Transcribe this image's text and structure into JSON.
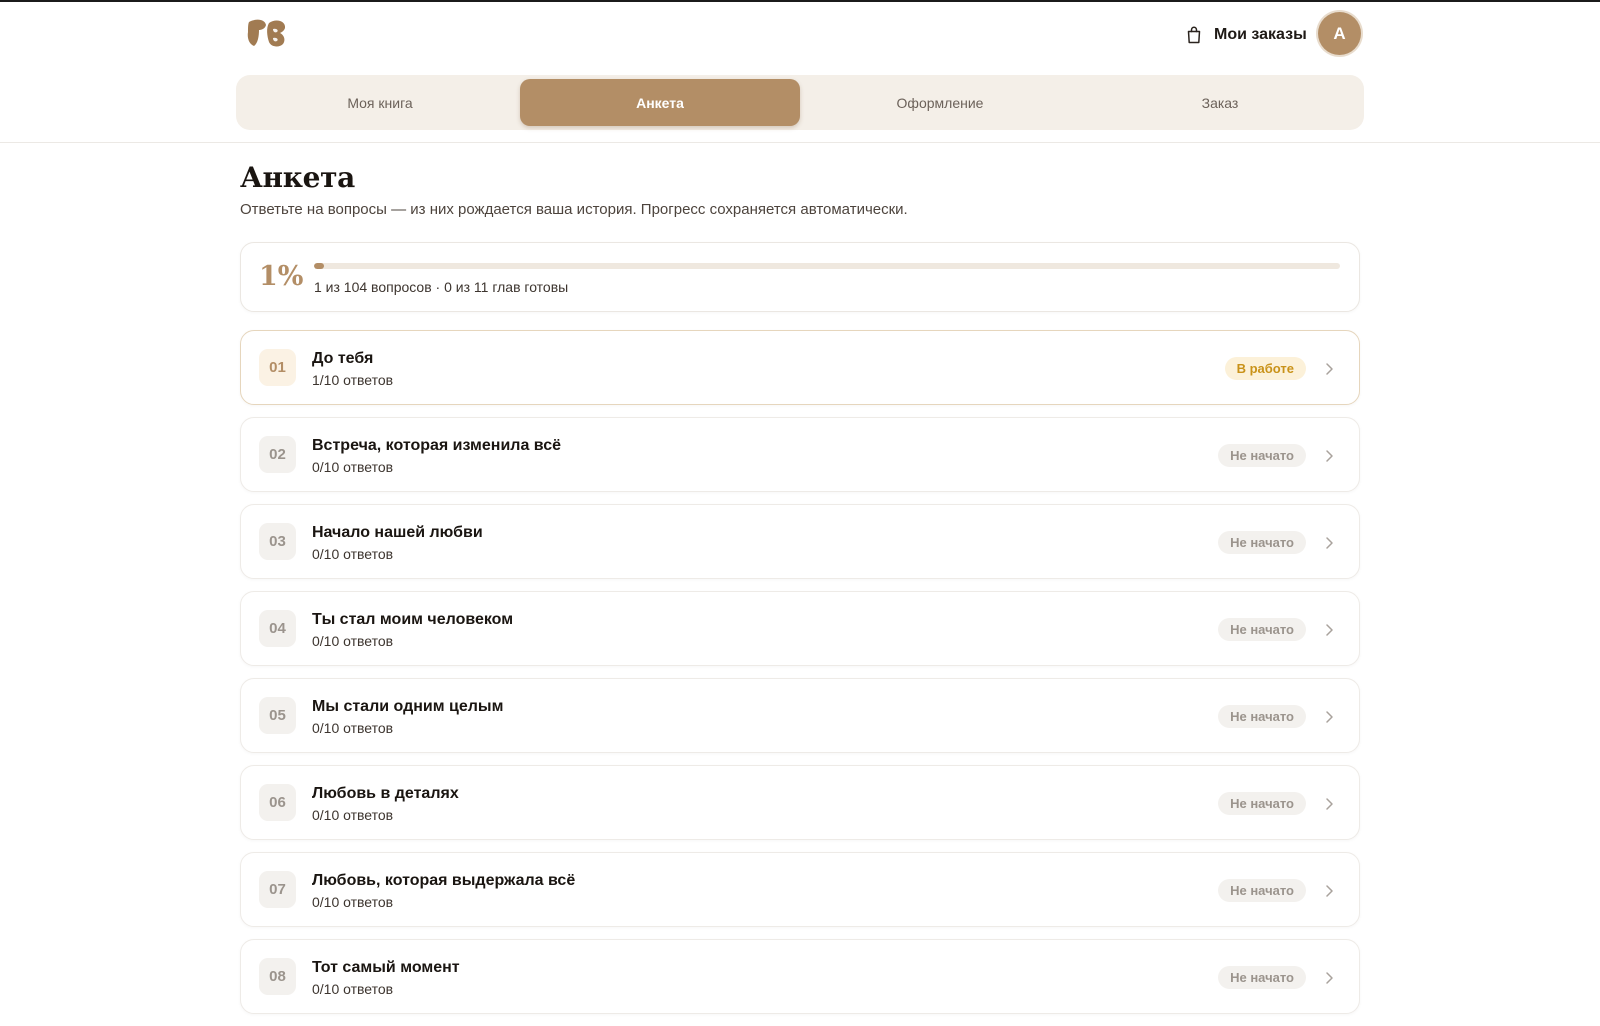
{
  "header": {
    "orders_label": "Мои заказы",
    "avatar_initial": "А"
  },
  "tabs": [
    {
      "label": "Моя книга",
      "active": false
    },
    {
      "label": "Анкета",
      "active": true
    },
    {
      "label": "Оформление",
      "active": false
    },
    {
      "label": "Заказ",
      "active": false
    }
  ],
  "page": {
    "title": "Анкета",
    "subtitle": "Ответьте на вопросы — из них рождается ваша история. Прогресс сохраняется автоматически."
  },
  "progress": {
    "percent_label": "1%",
    "percent_value": 1,
    "summary": "1 из 104 вопросов · 0 из 11 глав готовы"
  },
  "chapters": [
    {
      "num": "01",
      "title": "До тебя",
      "answers": "1/10 ответов",
      "status": "В работе",
      "state": "progress"
    },
    {
      "num": "02",
      "title": "Встреча, которая изменила всё",
      "answers": "0/10 ответов",
      "status": "Не начато",
      "state": "none"
    },
    {
      "num": "03",
      "title": "Начало нашей любви",
      "answers": "0/10 ответов",
      "status": "Не начато",
      "state": "none"
    },
    {
      "num": "04",
      "title": "Ты стал моим человеком",
      "answers": "0/10 ответов",
      "status": "Не начато",
      "state": "none"
    },
    {
      "num": "05",
      "title": "Мы стали одним целым",
      "answers": "0/10 ответов",
      "status": "Не начато",
      "state": "none"
    },
    {
      "num": "06",
      "title": "Любовь в деталях",
      "answers": "0/10 ответов",
      "status": "Не начато",
      "state": "none"
    },
    {
      "num": "07",
      "title": "Любовь, которая выдержала всё",
      "answers": "0/10 ответов",
      "status": "Не начато",
      "state": "none"
    },
    {
      "num": "08",
      "title": "Тот самый момент",
      "answers": "0/10 ответов",
      "status": "Не начато",
      "state": "none"
    }
  ],
  "colors": {
    "accent": "#b38e66",
    "tab_bar": "#f4efe8",
    "in_progress_bg": "#fcf1d9",
    "in_progress_text": "#c99219",
    "not_started_bg": "#f3f1ee",
    "not_started_text": "#9b948d"
  },
  "icons": {
    "logo": "brand-logo-icon",
    "orders": "shopping-bag-icon",
    "chapter_arrow": "chevron-right-icon"
  }
}
